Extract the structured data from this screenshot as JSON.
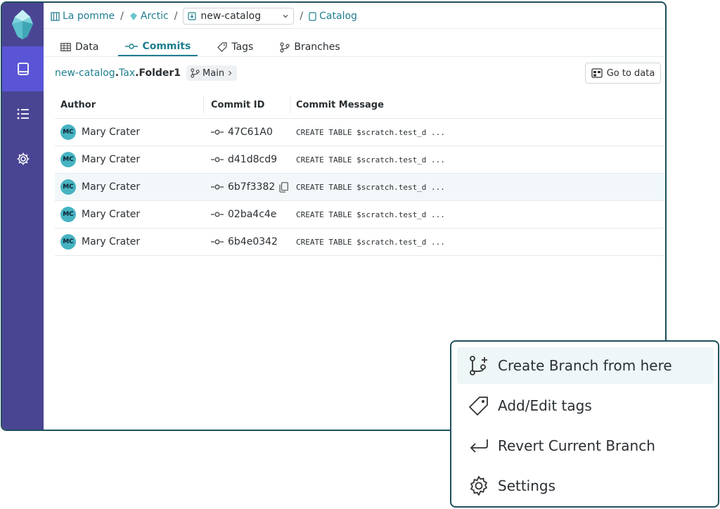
{
  "breadcrumb": {
    "org": "La pomme",
    "project": "Arctic",
    "branch_select": "new-catalog",
    "catalog": "Catalog"
  },
  "tabs": [
    {
      "label": "Data",
      "icon": "table-icon"
    },
    {
      "label": "Commits",
      "icon": "commit-icon",
      "active": true
    },
    {
      "label": "Tags",
      "icon": "tag-icon"
    },
    {
      "label": "Branches",
      "icon": "branch-icon"
    }
  ],
  "path": {
    "seg1": "new-catalog",
    "seg2": "Tax",
    "seg3": "Folder1",
    "ref": "Main"
  },
  "goto_label": "Go to data",
  "table": {
    "headers": [
      "Author",
      "Commit ID",
      "Commit Message"
    ],
    "rows": [
      {
        "initials": "MC",
        "author": "Mary Crater",
        "id": "47C61A0",
        "msg": "CREATE TABLE $scratch.test_d ..."
      },
      {
        "initials": "MC",
        "author": "Mary Crater",
        "id": "d41d8cd9",
        "msg": "CREATE TABLE $scratch.test_d ..."
      },
      {
        "initials": "MC",
        "author": "Mary Crater",
        "id": "6b7f3382",
        "msg": "CREATE TABLE $scratch.test_d ..."
      },
      {
        "initials": "MC",
        "author": "Mary Crater",
        "id": "02ba4c4e",
        "msg": "CREATE TABLE $scratch.test_d ..."
      },
      {
        "initials": "MC",
        "author": "Mary Crater",
        "id": "6b4e0342",
        "msg": "CREATE TABLE $scratch.test_d ..."
      }
    ]
  },
  "menu": {
    "items": [
      {
        "label": "Create Branch from here",
        "icon": "branch-plus-icon"
      },
      {
        "label": "Add/Edit tags",
        "icon": "tag-icon"
      },
      {
        "label": "Revert Current Branch",
        "icon": "revert-icon"
      },
      {
        "label": "Settings",
        "icon": "gear-icon"
      }
    ]
  },
  "colors": {
    "rail": "#4a4593",
    "rail_active": "#5a55d6",
    "accent": "#1f7e8f",
    "avatar": "#46b3c1",
    "frame": "#1f4f5c"
  }
}
